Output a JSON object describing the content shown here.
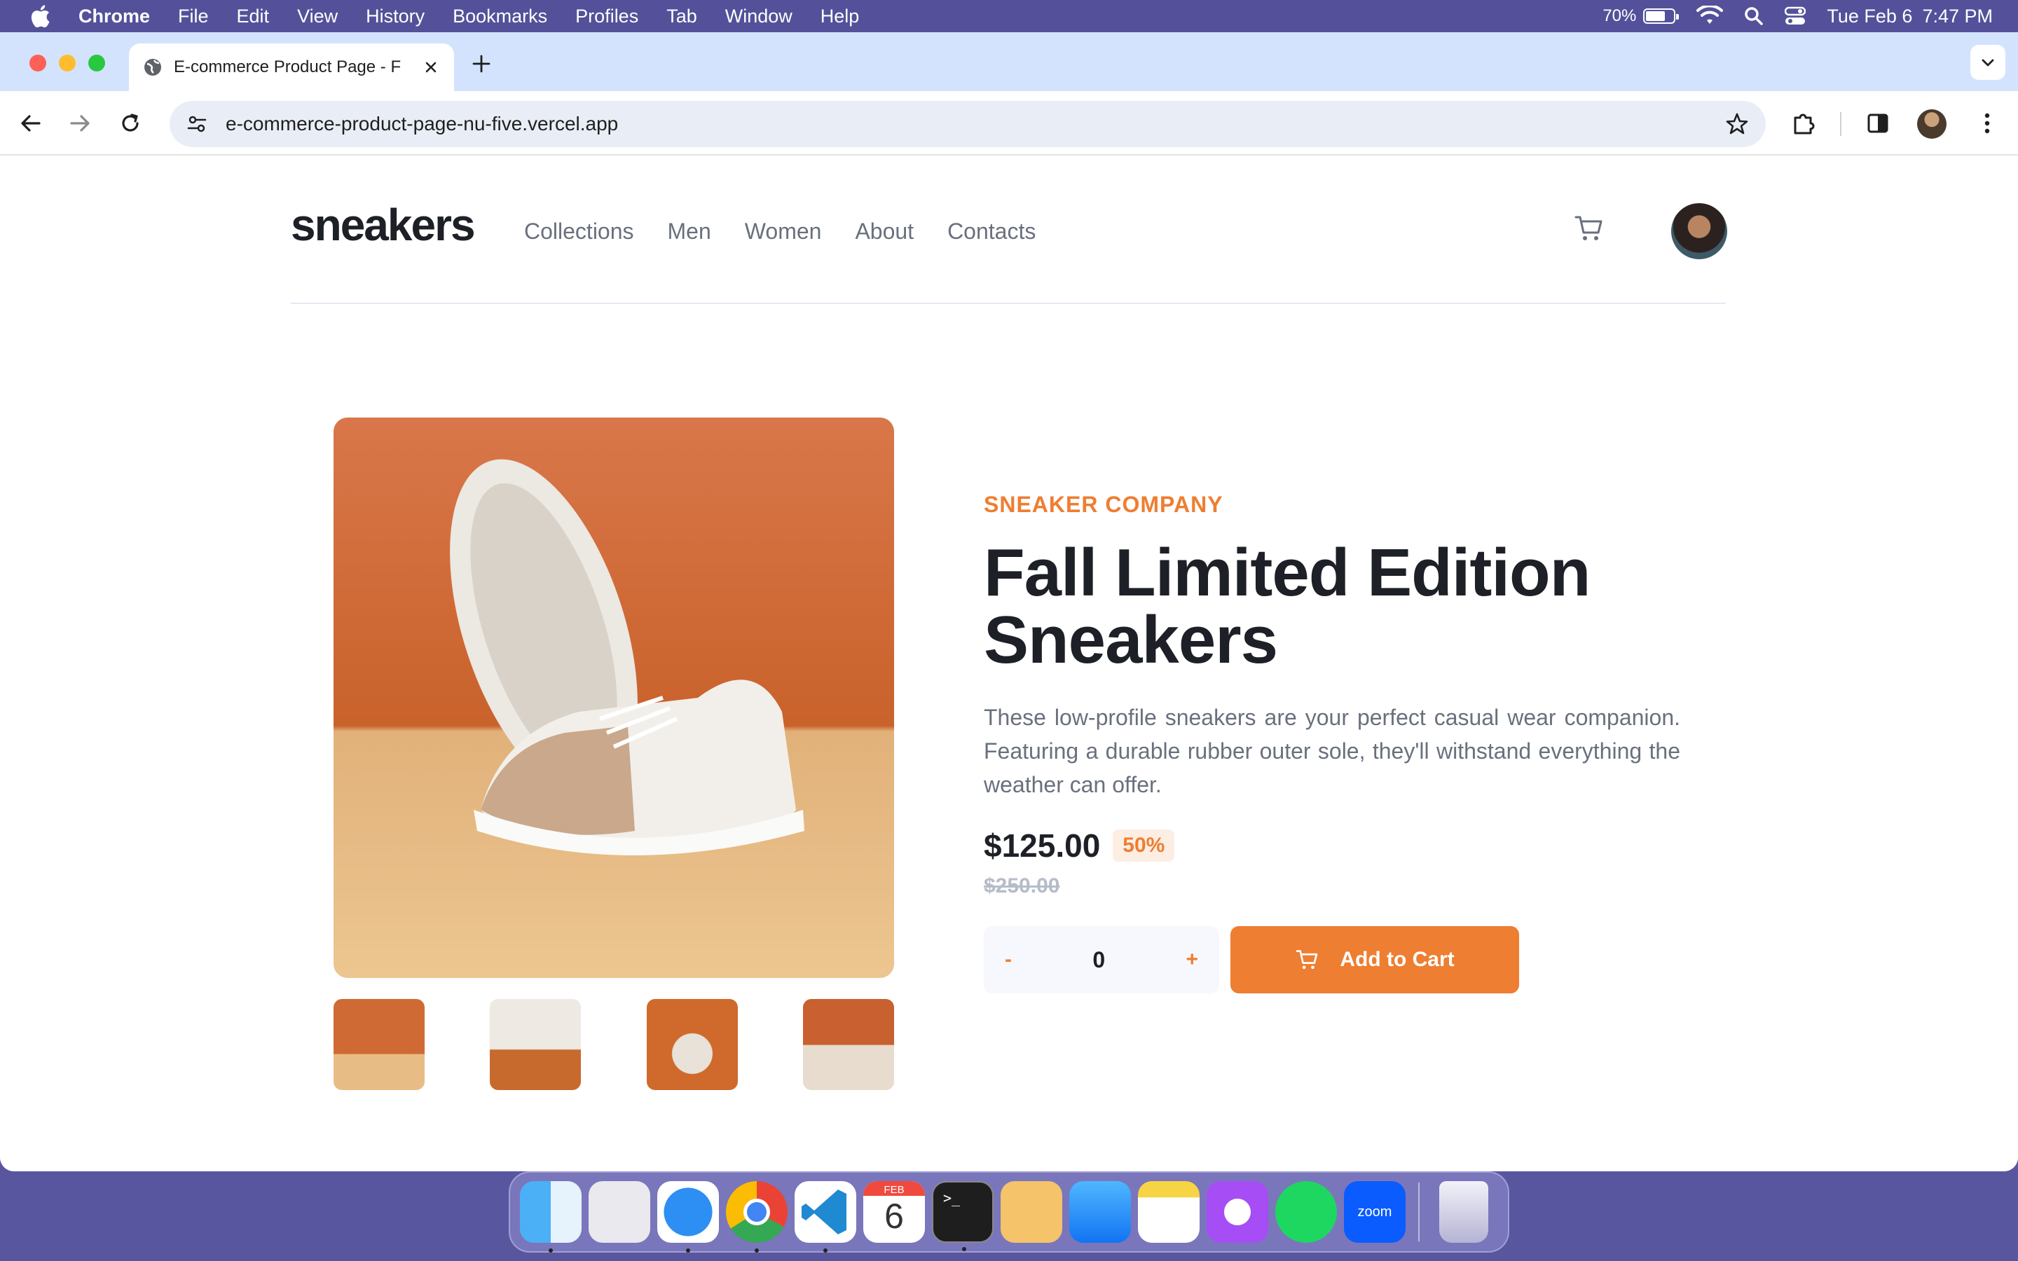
{
  "menubar": {
    "app_name": "Chrome",
    "menus": [
      "File",
      "Edit",
      "View",
      "History",
      "Bookmarks",
      "Profiles",
      "Tab",
      "Window",
      "Help"
    ],
    "battery_percent": "70%",
    "battery_level": 0.7,
    "date": "Tue Feb 6",
    "time": "7:47 PM"
  },
  "browser": {
    "tab_title": "E-commerce Product Page - F",
    "url": "e-commerce-product-page-nu-five.vercel.app"
  },
  "site": {
    "logo": "sneakers",
    "nav": [
      "Collections",
      "Men",
      "Women",
      "About",
      "Contacts"
    ]
  },
  "product": {
    "company": "SNEAKER COMPANY",
    "title": "Fall Limited Edition Sneakers",
    "description": "These low-profile sneakers are your perfect casual wear companion. Featuring a durable rubber outer sole, they'll withstand everything the weather can offer.",
    "price": "$125.00",
    "discount": "50%",
    "original_price": "$250.00",
    "quantity": "0",
    "minus_label": "-",
    "plus_label": "+",
    "add_to_cart_label": "Add to Cart",
    "accent_color": "#ee7e31"
  },
  "dock": {
    "calendar_month": "FEB",
    "calendar_day": "6",
    "zoom_label": "zoom",
    "apps": [
      "finder",
      "launchpad",
      "safari",
      "chrome",
      "vscode",
      "calendar",
      "terminal",
      "tableplus",
      "xcode-instruments",
      "notes",
      "messenger",
      "spotify",
      "zoom",
      "trash"
    ]
  }
}
